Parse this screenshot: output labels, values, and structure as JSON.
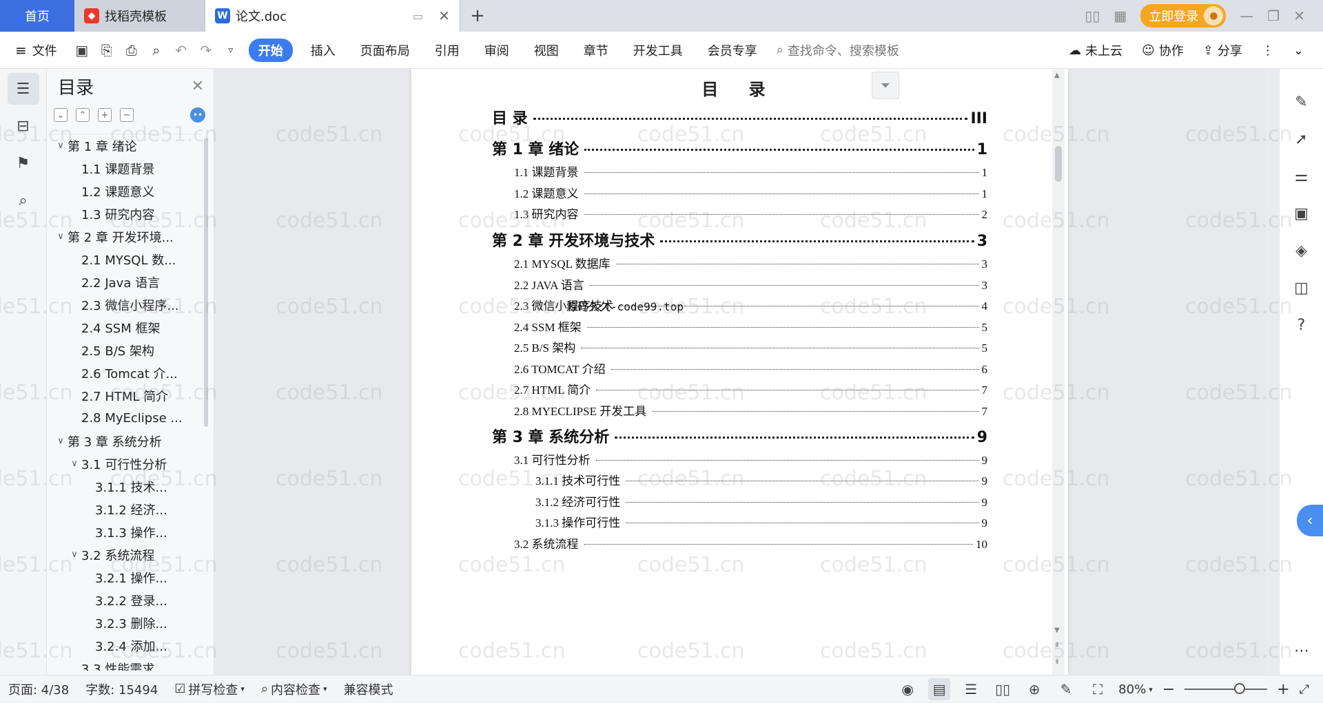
{
  "tabs": {
    "home": "首页",
    "template": "找稻壳模板",
    "doc": "论文.doc",
    "login": "立即登录"
  },
  "menu": {
    "file": "文件",
    "items": [
      "开始",
      "插入",
      "页面布局",
      "引用",
      "审阅",
      "视图",
      "章节",
      "开发工具",
      "会员专享"
    ],
    "search_placeholder": "查找命令、搜索模板",
    "cloud": "未上云",
    "collab": "协作",
    "share": "分享"
  },
  "toc_panel": {
    "title": "目录",
    "items": [
      {
        "label": "第 1 章  绪论",
        "level": 0,
        "expanded": true
      },
      {
        "label": "1.1  课题背景",
        "level": 1
      },
      {
        "label": "1.2  课题意义",
        "level": 1
      },
      {
        "label": "1.3  研究内容",
        "level": 1
      },
      {
        "label": "第 2 章  开发环境...",
        "level": 0,
        "expanded": true
      },
      {
        "label": "2.1 MYSQL 数...",
        "level": 1
      },
      {
        "label": "2.2 Java 语言",
        "level": 1
      },
      {
        "label": "2.3  微信小程序...",
        "level": 1
      },
      {
        "label": "2.4 SSM 框架",
        "level": 1
      },
      {
        "label": "2.5 B/S 架构",
        "level": 1
      },
      {
        "label": "2.6 Tomcat  介...",
        "level": 1
      },
      {
        "label": "2.7 HTML 简介",
        "level": 1
      },
      {
        "label": "2.8 MyEclipse ...",
        "level": 1
      },
      {
        "label": "第 3 章  系统分析",
        "level": 0,
        "expanded": true
      },
      {
        "label": "3.1  可行性分析",
        "level": 1,
        "expanded": true
      },
      {
        "label": "3.1.1  技术...",
        "level": 2
      },
      {
        "label": "3.1.2  经济...",
        "level": 2
      },
      {
        "label": "3.1.3  操作...",
        "level": 2
      },
      {
        "label": "3.2  系统流程",
        "level": 1,
        "expanded": true
      },
      {
        "label": "3.2.1  操作...",
        "level": 2
      },
      {
        "label": "3.2.2  登录...",
        "level": 2
      },
      {
        "label": "3.2.3  删除...",
        "level": 2
      },
      {
        "label": "3.2.4  添加...",
        "level": 2
      },
      {
        "label": "3.3  性能需求",
        "level": 1
      }
    ]
  },
  "document": {
    "title": "目  录",
    "entries": [
      {
        "text": "目  录",
        "page": "III",
        "level": 0
      },
      {
        "text": "第 1 章  绪论",
        "page": "1",
        "level": 0
      },
      {
        "text": "1.1  课题背景",
        "page": "1",
        "level": 1
      },
      {
        "text": "1.2  课题意义",
        "page": "1",
        "level": 1
      },
      {
        "text": "1.3  研究内容",
        "page": "2",
        "level": 1
      },
      {
        "text": "第 2 章  开发环境与技术",
        "page": "3",
        "level": 0
      },
      {
        "text": "2.1 MYSQL 数据库",
        "page": "3",
        "level": 1
      },
      {
        "text": "2.2 JAVA 语言",
        "page": "3",
        "level": 1
      },
      {
        "text": "2.3  微信小程序技术",
        "page": "4",
        "level": 1
      },
      {
        "text": "2.4 SSM 框架",
        "page": "5",
        "level": 1
      },
      {
        "text": "2.5 B/S 架构",
        "page": "5",
        "level": 1
      },
      {
        "text": "2.6 TOMCAT  介绍",
        "page": "6",
        "level": 1
      },
      {
        "text": "2.7 HTML 简介",
        "page": "7",
        "level": 1
      },
      {
        "text": "2.8 MYECLIPSE 开发工具",
        "page": "7",
        "level": 1
      },
      {
        "text": "第 3 章  系统分析",
        "page": "9",
        "level": 0
      },
      {
        "text": "3.1  可行性分析",
        "page": "9",
        "level": 1
      },
      {
        "text": "3.1.1  技术可行性",
        "page": "9",
        "level": 2
      },
      {
        "text": "3.1.2  经济可行性",
        "page": "9",
        "level": 2
      },
      {
        "text": "3.1.3  操作可行性",
        "page": "9",
        "level": 2
      },
      {
        "text": "3.2  系统流程",
        "page": "10",
        "level": 1
      }
    ],
    "overlay_text": "源码久久-code99.top"
  },
  "watermark": "code51.cn",
  "status": {
    "page": "页面: 4/38",
    "words": "字数: 15494",
    "spell": "拼写检查",
    "content": "内容检查",
    "compat": "兼容模式",
    "zoom": "80%"
  },
  "colors": {
    "accent": "#3b7cf0",
    "home_tab": "#3b6fe0",
    "login": "#f5a623"
  }
}
